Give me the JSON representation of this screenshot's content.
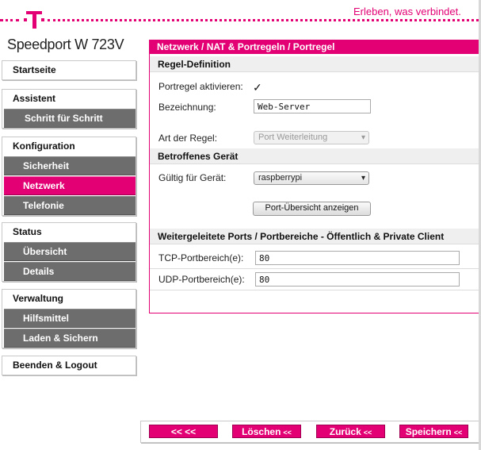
{
  "header": {
    "slogan": "Erleben, was verbindet.",
    "product": "Speedport W 723V",
    "logo_icon": "telekom-t-logo",
    "brand_color": "#e20074"
  },
  "sidebar": {
    "startseite": "Startseite",
    "assistent": {
      "label": "Assistent",
      "items": [
        "Schritt für Schritt"
      ]
    },
    "konfiguration": {
      "label": "Konfiguration",
      "items": [
        "Sicherheit",
        "Netzwerk",
        "Telefonie"
      ],
      "active": "Netzwerk"
    },
    "status": {
      "label": "Status",
      "items": [
        "Übersicht",
        "Details"
      ]
    },
    "verwaltung": {
      "label": "Verwaltung",
      "items": [
        "Hilfsmittel",
        "Laden & Sichern"
      ]
    },
    "logout": "Beenden & Logout"
  },
  "panel": {
    "title": "Netzwerk / NAT & Portregeln / Portregel",
    "section1": "Regel-Definition",
    "activate_label": "Portregel aktivieren:",
    "activate_checked": true,
    "name_label": "Bezeichnung:",
    "name_value": "Web-Server",
    "rule_type_label": "Art der Regel:",
    "rule_type_value": "Port Weiterleitung",
    "section2": "Betroffenes Gerät",
    "device_label": "Gültig für Gerät:",
    "device_value": "raspberrypi",
    "port_overview_button": "Port-Übersicht anzeigen",
    "section3": "Weitergeleitete Ports / Portbereiche - Öffentlich & Private Client",
    "tcp_label": "TCP-Portbereich(e):",
    "tcp_value": "80",
    "udp_label": "UDP-Portbereich(e):",
    "udp_value": "80"
  },
  "footer": {
    "back_arrows": "<<  <<",
    "delete": "Löschen",
    "back": "Zurück",
    "save": "Speichern",
    "arrow_suffix": "<<"
  }
}
